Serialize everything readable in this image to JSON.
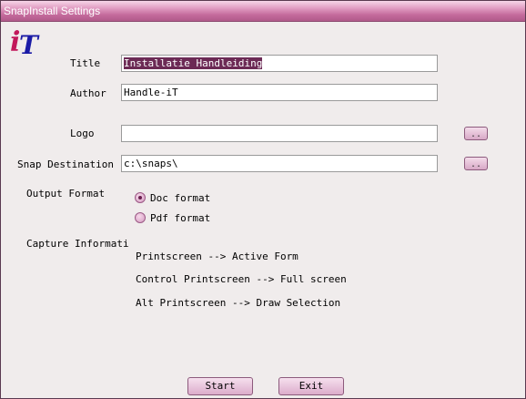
{
  "window": {
    "title": "SnapInstall Settings"
  },
  "logo": {
    "text_i": "i",
    "text_t": "T"
  },
  "form": {
    "title_label": "Title",
    "title_value": "Installatie Handleiding",
    "author_label": "Author",
    "author_value": "Handle-iT",
    "logo_label": "Logo",
    "logo_value": "",
    "dest_label": "Snap Destination",
    "dest_value": "c:\\snaps\\",
    "browse_label": ".."
  },
  "output_format": {
    "label": "Output Format",
    "options": [
      {
        "label": "Doc format",
        "checked": true
      },
      {
        "label": "Pdf format",
        "checked": false
      }
    ]
  },
  "capture": {
    "label": "Capture Informati",
    "lines": [
      "Printscreen --> Active Form",
      "Control Printscreen --> Full screen",
      "Alt Printscreen --> Draw Selection"
    ]
  },
  "buttons": {
    "start": "Start",
    "exit": "Exit"
  },
  "colors": {
    "accent": "#c46a9c",
    "logo_i": "#c2185b",
    "logo_t": "#1a1aa6"
  }
}
